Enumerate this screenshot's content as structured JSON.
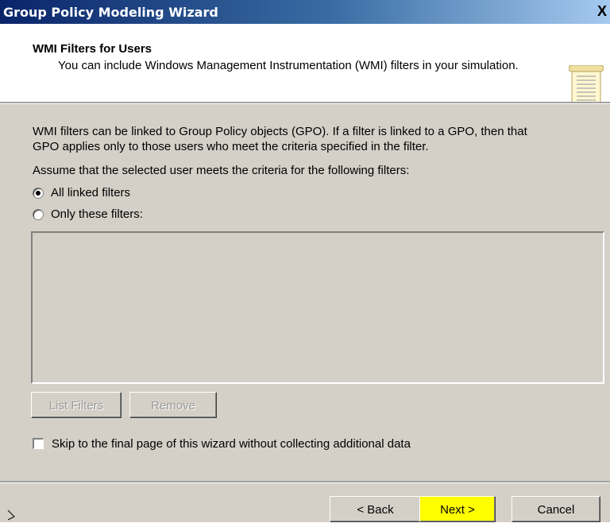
{
  "window": {
    "title": "Group Policy Modeling Wizard",
    "close_label": "X"
  },
  "header": {
    "title": "WMI Filters for Users",
    "subtitle": "You can include Windows Management Instrumentation (WMI) filters in your simulation."
  },
  "body": {
    "description_line1": "WMI filters can be linked to Group Policy objects (GPO). If a filter is linked to a GPO, then that",
    "description_line2": "GPO applies only to those users who meet the criteria specified in the filter.",
    "assume_text": "Assume that the selected user meets the criteria for the following filters:",
    "radio_all": {
      "label": "All linked filters",
      "checked": true
    },
    "radio_only": {
      "label": "Only these filters:",
      "checked": false
    },
    "list_filters_label": "List Filters",
    "remove_label": "Remove",
    "skip_checkbox": {
      "label": "Skip to the final page of this wizard without collecting additional data",
      "checked": false
    }
  },
  "footer": {
    "back_label": "< Back",
    "next_label": "Next >",
    "cancel_label": "Cancel",
    "next_highlight_color": "#ffff00"
  },
  "colors": {
    "title_gradient_start": "#0a246a",
    "dialog_face": "#d4d0c8"
  }
}
